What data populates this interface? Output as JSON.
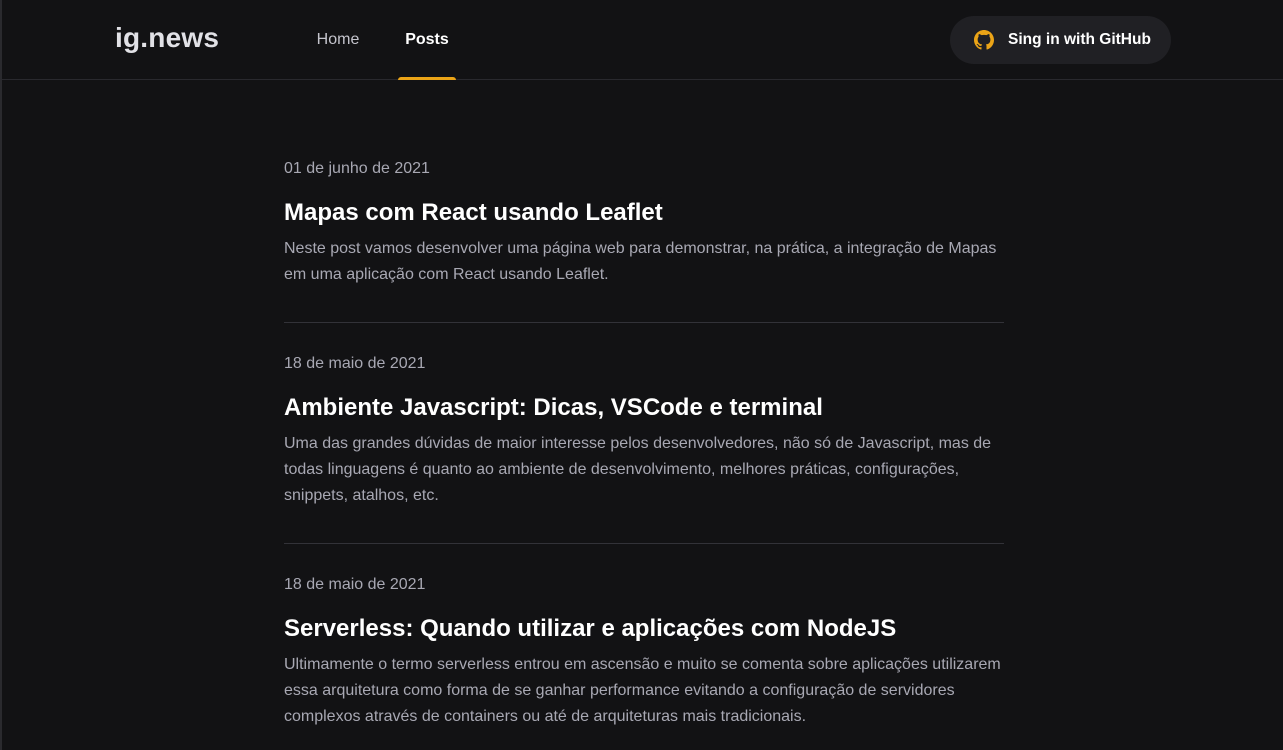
{
  "header": {
    "logo": "ig.news",
    "nav": {
      "home": "Home",
      "posts": "Posts"
    },
    "signin_label": "Sing in with GitHub",
    "accent_color": "#eba417"
  },
  "posts": [
    {
      "date": "01 de junho de 2021",
      "title": "Mapas com React usando Leaflet",
      "excerpt": "Neste post vamos desenvolver uma página web para demonstrar, na prática, a integração de Mapas em uma aplicação com React usando Leaflet."
    },
    {
      "date": "18 de maio de 2021",
      "title": "Ambiente Javascript: Dicas, VSCode e terminal",
      "excerpt": "Uma das grandes dúvidas de maior interesse pelos desenvolvedores, não só de Javascript, mas de todas linguagens é quanto ao ambiente de desenvolvimento, melhores práticas, configurações, snippets, atalhos, etc."
    },
    {
      "date": "18 de maio de 2021",
      "title": "Serverless: Quando utilizar e aplicações com NodeJS",
      "excerpt": "Ultimamente o termo serverless entrou em ascensão e muito se comenta sobre aplicações utilizarem essa arquitetura como forma de se ganhar performance evitando a configuração de servidores complexos através de containers ou até de arquiteturas mais tradicionais."
    }
  ],
  "icons": {
    "signin": "github-icon"
  }
}
